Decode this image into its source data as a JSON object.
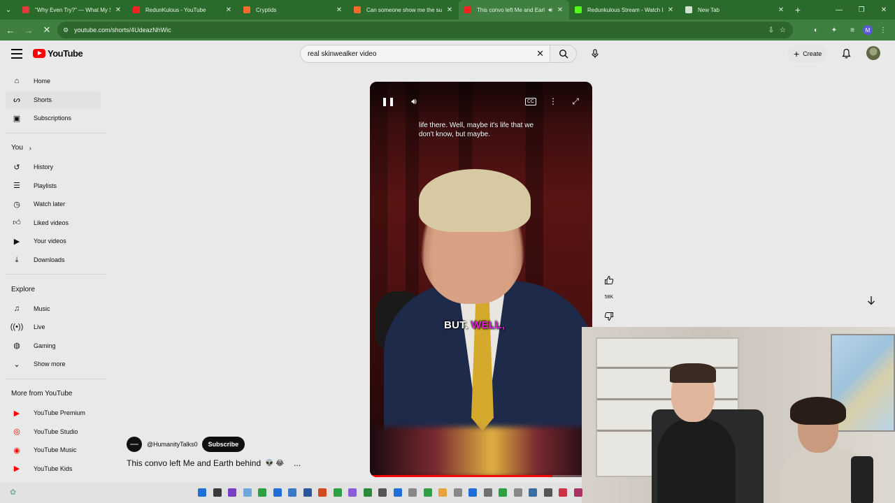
{
  "browser": {
    "tabs": [
      {
        "title": "\"Why Even Try?\" — What My S",
        "favicon_color": "#e23b3b",
        "active": false
      },
      {
        "title": "RedunKulous - YouTube",
        "favicon_color": "#ff2020",
        "active": false
      },
      {
        "title": "Cryptids",
        "favicon_color": "#ff6b2d",
        "active": false
      },
      {
        "title": "Can someone show me the su",
        "favicon_color": "#ff6b2d",
        "active": false
      },
      {
        "title": "This convo left Me and Earl",
        "favicon_color": "#ff2020",
        "active": true
      },
      {
        "title": "Redunkulous Stream - Watch L",
        "favicon_color": "#53fc18",
        "active": false
      },
      {
        "title": "New Tab",
        "favicon_color": "#cfe3cf",
        "active": false
      }
    ],
    "url": "youtube.com/shorts/4UdeazNhWic",
    "profile_letter": "M"
  },
  "youtube": {
    "logo_text": "YouTube",
    "search_value": "real  skinwealker video",
    "create_label": "Create",
    "sidebar": {
      "main": [
        "Home",
        "Shorts",
        "Subscriptions"
      ],
      "you_header": "You",
      "you": [
        "History",
        "Playlists",
        "Watch later",
        "Liked videos",
        "Your videos",
        "Downloads"
      ],
      "explore_header": "Explore",
      "explore": [
        "Music",
        "Live",
        "Gaming",
        "Show more"
      ],
      "more_header": "More from YouTube",
      "more": [
        "YouTube Premium",
        "YouTube Studio",
        "YouTube Music",
        "YouTube Kids"
      ]
    },
    "short": {
      "caption_top": "life there. Well, maybe it's life that we don't know, but maybe.",
      "caption_word1": "BUT.",
      "caption_word2": "WELL,",
      "progress_fraction": 0.82,
      "likes": "58K",
      "channel": "@HumanityTalks0",
      "subscribe_label": "Subscribe",
      "title": "This convo left Me and Earth behind",
      "title_emojis": "👽 😂",
      "more": "..."
    }
  },
  "colors": {
    "browser_frame": "#2a6a2a",
    "browser_toolbar": "#3f7f3f",
    "youtube_red": "#ff0000",
    "caption_highlight": "#e020e0"
  }
}
